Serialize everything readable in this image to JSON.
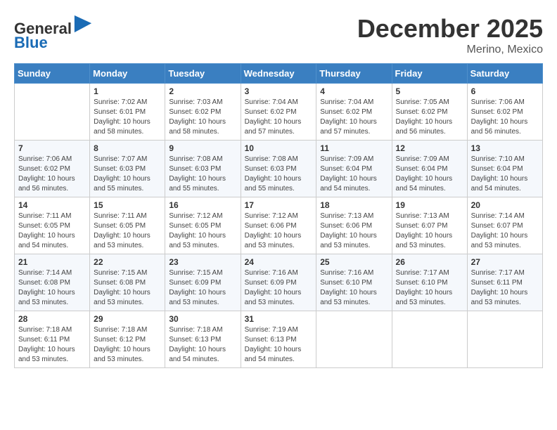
{
  "header": {
    "logo_line1": "General",
    "logo_line2": "Blue",
    "title": "December 2025",
    "subtitle": "Merino, Mexico"
  },
  "calendar": {
    "days_of_week": [
      "Sunday",
      "Monday",
      "Tuesday",
      "Wednesday",
      "Thursday",
      "Friday",
      "Saturday"
    ],
    "weeks": [
      [
        {
          "day": "",
          "info": ""
        },
        {
          "day": "1",
          "info": "Sunrise: 7:02 AM\nSunset: 6:01 PM\nDaylight: 10 hours\nand 58 minutes."
        },
        {
          "day": "2",
          "info": "Sunrise: 7:03 AM\nSunset: 6:02 PM\nDaylight: 10 hours\nand 58 minutes."
        },
        {
          "day": "3",
          "info": "Sunrise: 7:04 AM\nSunset: 6:02 PM\nDaylight: 10 hours\nand 57 minutes."
        },
        {
          "day": "4",
          "info": "Sunrise: 7:04 AM\nSunset: 6:02 PM\nDaylight: 10 hours\nand 57 minutes."
        },
        {
          "day": "5",
          "info": "Sunrise: 7:05 AM\nSunset: 6:02 PM\nDaylight: 10 hours\nand 56 minutes."
        },
        {
          "day": "6",
          "info": "Sunrise: 7:06 AM\nSunset: 6:02 PM\nDaylight: 10 hours\nand 56 minutes."
        }
      ],
      [
        {
          "day": "7",
          "info": "Sunrise: 7:06 AM\nSunset: 6:02 PM\nDaylight: 10 hours\nand 56 minutes."
        },
        {
          "day": "8",
          "info": "Sunrise: 7:07 AM\nSunset: 6:03 PM\nDaylight: 10 hours\nand 55 minutes."
        },
        {
          "day": "9",
          "info": "Sunrise: 7:08 AM\nSunset: 6:03 PM\nDaylight: 10 hours\nand 55 minutes."
        },
        {
          "day": "10",
          "info": "Sunrise: 7:08 AM\nSunset: 6:03 PM\nDaylight: 10 hours\nand 55 minutes."
        },
        {
          "day": "11",
          "info": "Sunrise: 7:09 AM\nSunset: 6:04 PM\nDaylight: 10 hours\nand 54 minutes."
        },
        {
          "day": "12",
          "info": "Sunrise: 7:09 AM\nSunset: 6:04 PM\nDaylight: 10 hours\nand 54 minutes."
        },
        {
          "day": "13",
          "info": "Sunrise: 7:10 AM\nSunset: 6:04 PM\nDaylight: 10 hours\nand 54 minutes."
        }
      ],
      [
        {
          "day": "14",
          "info": "Sunrise: 7:11 AM\nSunset: 6:05 PM\nDaylight: 10 hours\nand 54 minutes."
        },
        {
          "day": "15",
          "info": "Sunrise: 7:11 AM\nSunset: 6:05 PM\nDaylight: 10 hours\nand 53 minutes."
        },
        {
          "day": "16",
          "info": "Sunrise: 7:12 AM\nSunset: 6:05 PM\nDaylight: 10 hours\nand 53 minutes."
        },
        {
          "day": "17",
          "info": "Sunrise: 7:12 AM\nSunset: 6:06 PM\nDaylight: 10 hours\nand 53 minutes."
        },
        {
          "day": "18",
          "info": "Sunrise: 7:13 AM\nSunset: 6:06 PM\nDaylight: 10 hours\nand 53 minutes."
        },
        {
          "day": "19",
          "info": "Sunrise: 7:13 AM\nSunset: 6:07 PM\nDaylight: 10 hours\nand 53 minutes."
        },
        {
          "day": "20",
          "info": "Sunrise: 7:14 AM\nSunset: 6:07 PM\nDaylight: 10 hours\nand 53 minutes."
        }
      ],
      [
        {
          "day": "21",
          "info": "Sunrise: 7:14 AM\nSunset: 6:08 PM\nDaylight: 10 hours\nand 53 minutes."
        },
        {
          "day": "22",
          "info": "Sunrise: 7:15 AM\nSunset: 6:08 PM\nDaylight: 10 hours\nand 53 minutes."
        },
        {
          "day": "23",
          "info": "Sunrise: 7:15 AM\nSunset: 6:09 PM\nDaylight: 10 hours\nand 53 minutes."
        },
        {
          "day": "24",
          "info": "Sunrise: 7:16 AM\nSunset: 6:09 PM\nDaylight: 10 hours\nand 53 minutes."
        },
        {
          "day": "25",
          "info": "Sunrise: 7:16 AM\nSunset: 6:10 PM\nDaylight: 10 hours\nand 53 minutes."
        },
        {
          "day": "26",
          "info": "Sunrise: 7:17 AM\nSunset: 6:10 PM\nDaylight: 10 hours\nand 53 minutes."
        },
        {
          "day": "27",
          "info": "Sunrise: 7:17 AM\nSunset: 6:11 PM\nDaylight: 10 hours\nand 53 minutes."
        }
      ],
      [
        {
          "day": "28",
          "info": "Sunrise: 7:18 AM\nSunset: 6:11 PM\nDaylight: 10 hours\nand 53 minutes."
        },
        {
          "day": "29",
          "info": "Sunrise: 7:18 AM\nSunset: 6:12 PM\nDaylight: 10 hours\nand 53 minutes."
        },
        {
          "day": "30",
          "info": "Sunrise: 7:18 AM\nSunset: 6:13 PM\nDaylight: 10 hours\nand 54 minutes."
        },
        {
          "day": "31",
          "info": "Sunrise: 7:19 AM\nSunset: 6:13 PM\nDaylight: 10 hours\nand 54 minutes."
        },
        {
          "day": "",
          "info": ""
        },
        {
          "day": "",
          "info": ""
        },
        {
          "day": "",
          "info": ""
        }
      ]
    ]
  }
}
